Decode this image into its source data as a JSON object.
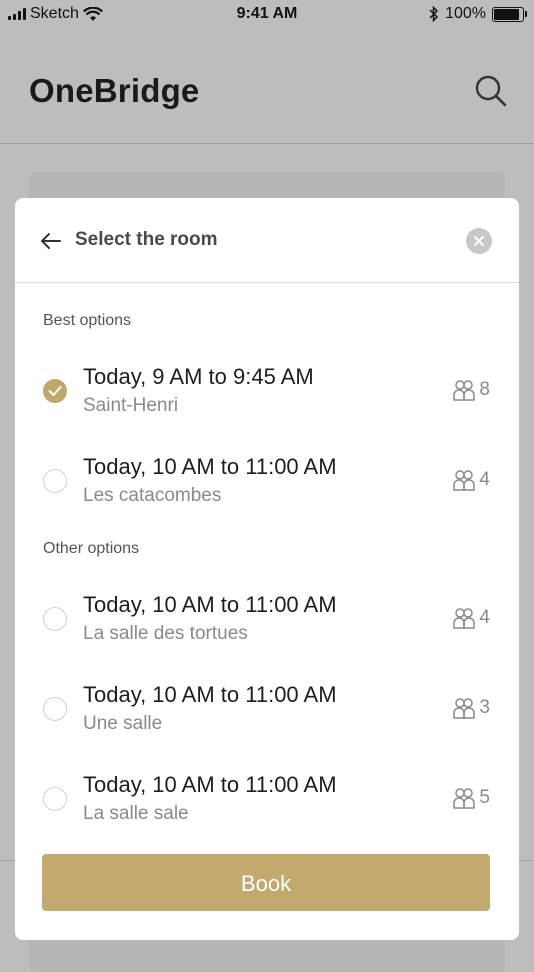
{
  "status_bar": {
    "carrier": "Sketch",
    "time": "9:41 AM",
    "battery_text": "100%",
    "battery_level": 1.0,
    "icons": [
      "signal-icon",
      "wifi-icon",
      "bluetooth-icon",
      "battery-icon"
    ]
  },
  "app": {
    "title": "OneBridge",
    "search_icon": "search-icon"
  },
  "modal": {
    "title": "Select the room",
    "back_icon": "arrow-left-icon",
    "close_icon": "close-icon",
    "best_label": "Best options",
    "other_label": "Other options",
    "best_options": [
      {
        "time": "Today, 9 AM to 9:45 AM",
        "room": "Saint-Henri",
        "capacity": "8",
        "selected": true
      },
      {
        "time": "Today, 10 AM to 11:00 AM",
        "room": "Les catacombes",
        "capacity": "4",
        "selected": false
      }
    ],
    "other_options": [
      {
        "time": "Today, 10 AM to 11:00 AM",
        "room": "La salle des tortues",
        "capacity": "4",
        "selected": false
      },
      {
        "time": "Today, 10 AM to 11:00 AM",
        "room": "Une salle",
        "capacity": "3",
        "selected": false
      },
      {
        "time": "Today, 10 AM to 11:00 AM",
        "room": "La salle sale",
        "capacity": "5",
        "selected": false
      }
    ],
    "book_label": "Book"
  },
  "colors": {
    "accent": "#C2AA6F",
    "overlay": "#BDBDBD",
    "muted_text": "#8A8A8A"
  }
}
